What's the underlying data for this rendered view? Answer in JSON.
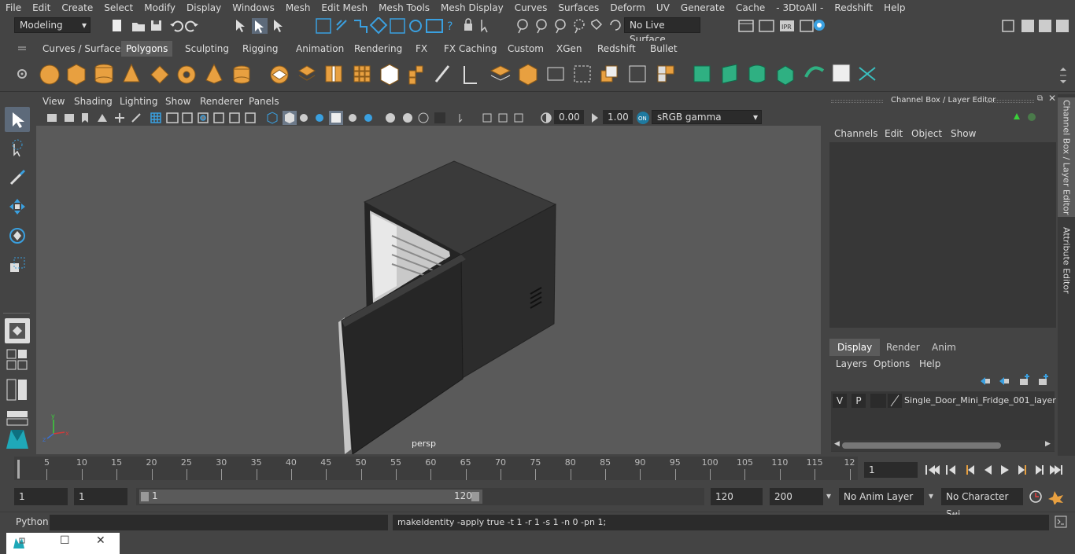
{
  "menu": [
    "File",
    "Edit",
    "Create",
    "Select",
    "Modify",
    "Display",
    "Windows",
    "Mesh",
    "Edit Mesh",
    "Mesh Tools",
    "Mesh Display",
    "Curves",
    "Surfaces",
    "Deform",
    "UV",
    "Generate",
    "Cache",
    "- 3DtoAll -",
    "Redshift",
    "Help"
  ],
  "status": {
    "mode": "Modeling",
    "live_surface": "No Live Surface"
  },
  "shelf_tabs": [
    "Curves / Surfaces",
    "Polygons",
    "Sculpting",
    "Rigging",
    "Animation",
    "Rendering",
    "FX",
    "FX Caching",
    "Custom",
    "XGen",
    "Redshift",
    "Bullet"
  ],
  "shelf_active": "Polygons",
  "panel_menu": [
    "View",
    "Shading",
    "Lighting",
    "Show",
    "Renderer",
    "Panels"
  ],
  "viewport": {
    "exposure": "0.00",
    "gamma": "1.00",
    "colorspace": "sRGB gamma",
    "camera": "persp"
  },
  "channel_box": {
    "title": "Channel Box / Layer Editor",
    "menu": [
      "Channels",
      "Edit",
      "Object",
      "Show"
    ]
  },
  "side_tabs": [
    "Channel Box / Layer Editor",
    "Attribute Editor"
  ],
  "layer_editor": {
    "tabs": [
      "Display",
      "Render",
      "Anim"
    ],
    "active_tab": "Display",
    "menu": [
      "Layers",
      "Options",
      "Help"
    ],
    "layers": [
      {
        "v": "V",
        "p": "P",
        "name": "Single_Door_Mini_Fridge_001_layer"
      }
    ]
  },
  "timeline": {
    "labels": [
      "5",
      "10",
      "15",
      "20",
      "25",
      "30",
      "35",
      "40",
      "45",
      "50",
      "55",
      "60",
      "65",
      "70",
      "75",
      "80",
      "85",
      "90",
      "95",
      "100",
      "105",
      "110",
      "115",
      "12"
    ],
    "current_frame_label": "1",
    "current_frame_field": "1"
  },
  "range": {
    "start": "1",
    "start2": "1",
    "range_start": "1",
    "range_end": "120",
    "end": "120",
    "end2": "200",
    "anim_layer": "No Anim Layer",
    "character_set": "No Character Set"
  },
  "command": {
    "language": "Python",
    "input": "",
    "result": "makeIdentity -apply true -t 1 -r 1 -s 1 -n 0 -pn 1;"
  },
  "colors": {
    "bg": "#444444",
    "viewport": "#5a5a5a",
    "field": "#2b2b2b",
    "accent": "#5d6a7a",
    "shelf_orange": "#e8a040",
    "shelf_green": "#2fb082"
  }
}
